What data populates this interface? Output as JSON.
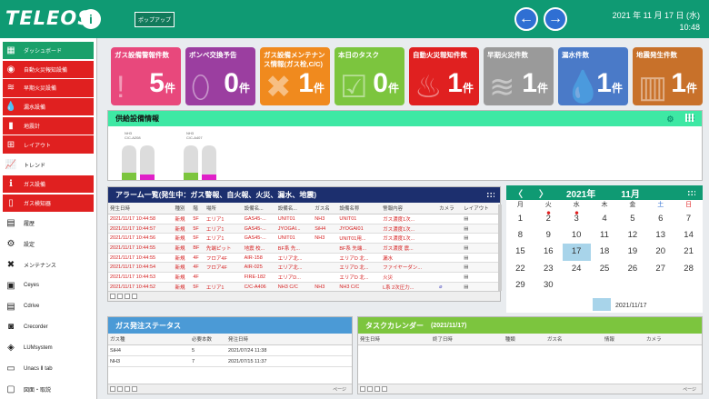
{
  "app": {
    "logo": "TELEOS",
    "logo_mark": "i",
    "popup_button": "ポップアップ"
  },
  "datetime": {
    "date": "2021 年 11 月 17 日 (水)",
    "time": "10:48"
  },
  "sidebar": {
    "items": [
      {
        "label": "ダッシュボード",
        "icon": "dashboard-icon",
        "style": "green",
        "glyph": "▦"
      },
      {
        "label": "自動火災報知設備",
        "icon": "fire-alarm-icon",
        "style": "red",
        "glyph": "◉"
      },
      {
        "label": "早期火災設備",
        "icon": "early-fire-icon",
        "style": "red",
        "glyph": "≋"
      },
      {
        "label": "漏水設備",
        "icon": "water-leak-icon",
        "style": "red",
        "glyph": "💧"
      },
      {
        "label": "地震計",
        "icon": "seismometer-icon",
        "style": "red",
        "glyph": "▮"
      },
      {
        "label": "レイアウト",
        "icon": "layout-icon",
        "style": "red",
        "glyph": "⊞"
      },
      {
        "label": "トレンド",
        "icon": "trend-icon",
        "style": "plain",
        "glyph": "📈"
      },
      {
        "label": "ガス設備",
        "icon": "gas-info-icon",
        "style": "red",
        "glyph": "ℹ"
      },
      {
        "label": "ガス検知器",
        "icon": "gas-detector-icon",
        "style": "red",
        "glyph": "▯"
      },
      {
        "label": "履歴",
        "icon": "history-icon",
        "style": "plain",
        "glyph": "▤"
      },
      {
        "label": "設定",
        "icon": "settings-icon",
        "style": "plain",
        "glyph": "⚙"
      },
      {
        "label": "メンテナンス",
        "icon": "maintenance-icon",
        "style": "plain",
        "glyph": "✖"
      },
      {
        "label": "Ceyes",
        "icon": "ceyes-icon",
        "style": "plain",
        "glyph": "▣"
      },
      {
        "label": "Cdrive",
        "icon": "cdrive-icon",
        "style": "plain",
        "glyph": "▤"
      },
      {
        "label": "Crecorder",
        "icon": "camera-icon",
        "style": "plain",
        "glyph": "◙"
      },
      {
        "label": "LUMsystem",
        "icon": "lum-system-icon",
        "style": "plain",
        "glyph": "◈"
      },
      {
        "label": "Unacs Ⅱ tab",
        "icon": "tablet-icon",
        "style": "plain",
        "glyph": "▭"
      },
      {
        "label": "図面・取説",
        "icon": "manual-icon",
        "style": "plain",
        "glyph": "▢"
      }
    ]
  },
  "tiles": [
    {
      "title": "ガス設備警報件数",
      "value": "5",
      "unit": "件",
      "color": "#e8487c",
      "icon": "alarm-bell-icon",
      "glyph": "!"
    },
    {
      "title": "ボンベ交換予告",
      "value": "0",
      "unit": "件",
      "color": "#9b3ea0",
      "icon": "cylinder-icon",
      "glyph": "⬯"
    },
    {
      "title": "ガス設備メンテナンス情報(ガス栓,C/C)",
      "value": "1",
      "unit": "件",
      "color": "#f08a1e",
      "icon": "wrench-icon",
      "glyph": "✖"
    },
    {
      "title": "本日のタスク",
      "value": "0",
      "unit": "件",
      "color": "#7cc53e",
      "icon": "task-icon",
      "glyph": "☑"
    },
    {
      "title": "自動火災報知件数",
      "value": "1",
      "unit": "件",
      "color": "#e02020",
      "icon": "flame-icon",
      "glyph": "♨"
    },
    {
      "title": "早期火災件数",
      "value": "1",
      "unit": "件",
      "color": "#9a9a9a",
      "icon": "smoke-icon",
      "glyph": "≋"
    },
    {
      "title": "漏水件数",
      "value": "1",
      "unit": "件",
      "color": "#4a7ac8",
      "icon": "water-drop-icon",
      "glyph": "💧"
    },
    {
      "title": "地震発生件数",
      "value": "1",
      "unit": "件",
      "color": "#c8712a",
      "icon": "building-icon",
      "glyph": "▥"
    }
  ],
  "supply": {
    "title": "供給設備情報",
    "tanks": [
      {
        "label": "NH3\nC/C-A208"
      },
      {
        "label": "NH3\nC/C-A407"
      }
    ]
  },
  "alarm": {
    "title": "アラーム一覧(発生中：ガス警報、自火報、火災、漏水、地震)",
    "columns": [
      "発生日時",
      "種別",
      "階",
      "場所",
      "設備名...",
      "設備名...",
      "ガス名",
      "設備名称",
      "警報内容",
      "カメラ",
      "レイアウト"
    ],
    "rows": [
      [
        "2021/11/17 10:44:58",
        "新規",
        "5F",
        "エリア1",
        "GAS45-...",
        "UNIT01",
        "NH3",
        "UNIT01",
        "ガス濃度1次..."
      ],
      [
        "2021/11/17 10:44:57",
        "新規",
        "5F",
        "エリア1",
        "GAS45-...",
        "JYOGAI...",
        "SiH4",
        "JYOGAI01",
        "ガス濃度1次..."
      ],
      [
        "2021/11/17 10:44:56",
        "新規",
        "5F",
        "エリア1",
        "GAS45-...",
        "UNIT01",
        "NH3",
        "UNIT01用...",
        "ガス濃度1次..."
      ],
      [
        "2021/11/17 10:44:55",
        "新規",
        "BF",
        "先端ピット",
        "地震 校...",
        "BF系 先...",
        "",
        "BF系 先端...",
        "ガス濃度 震..."
      ],
      [
        "2021/11/17 10:44:55",
        "新規",
        "4F",
        "フロア4F",
        "AIR-158",
        "エリア北...",
        "",
        "エリアD 北...",
        "漏水"
      ],
      [
        "2021/11/17 10:44:54",
        "新規",
        "4F",
        "フロア4F",
        "AIR-025",
        "エリア北...",
        "",
        "エリアD 北...",
        "ファイヤーダン..."
      ],
      [
        "2021/11/17 10:44:53",
        "新規",
        "4F",
        "",
        "FIRE-182",
        "エリアD...",
        "",
        "エリアD 北...",
        "火災"
      ],
      [
        "2021/11/17 10:44:52",
        "新規",
        "5F",
        "エリア1",
        "C/C-A406",
        "NH3 C/C",
        "NH3",
        "NH3 C/C",
        "L系 2次圧力..."
      ]
    ]
  },
  "calendar": {
    "year": "2021年",
    "month": "11月",
    "days_of_week": [
      "月",
      "火",
      "水",
      "木",
      "金",
      "土",
      "日"
    ],
    "weeks": [
      [
        "1",
        "2",
        "3",
        "4",
        "5",
        "6",
        "7"
      ],
      [
        "8",
        "9",
        "10",
        "11",
        "12",
        "13",
        "14"
      ],
      [
        "15",
        "16",
        "17",
        "18",
        "19",
        "20",
        "21"
      ],
      [
        "22",
        "23",
        "24",
        "25",
        "26",
        "27",
        "28"
      ],
      [
        "29",
        "30",
        "",
        "",
        "",
        "",
        ""
      ]
    ],
    "today_legend": "2021/11/17"
  },
  "gas_order": {
    "title": "ガス発注ステータス",
    "columns": [
      "ガス種",
      "必要本数",
      "発注日時"
    ],
    "rows": [
      [
        "SiH4",
        "5",
        "2021/07/24 11:38"
      ],
      [
        "NH3",
        "7",
        "2021/07/15 11:37"
      ]
    ]
  },
  "task_calendar": {
    "title": "タスクカレンダー",
    "date": "(2021/11/17)",
    "columns": [
      "発生日時",
      "終了日時",
      "種類",
      "ガス名",
      "情報",
      "カメラ"
    ]
  },
  "pager_label": "ページ",
  "colors": {
    "brand": "#0f9a73",
    "alarm_red": "#e02020",
    "accent_blue": "#2f6fd3"
  }
}
